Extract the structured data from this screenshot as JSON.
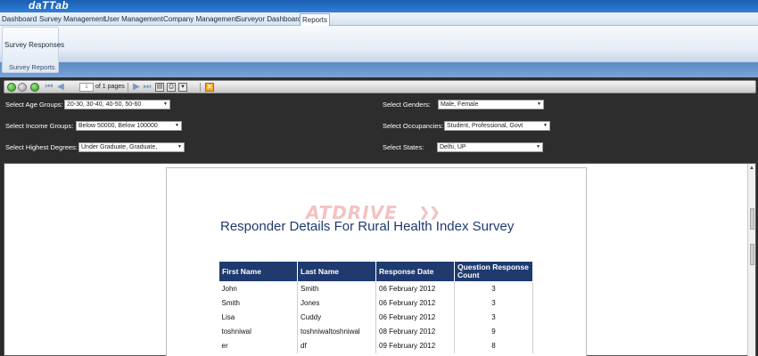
{
  "brand": "daTTab",
  "menu": [
    "Dashboard",
    "Survey Management",
    "User Management",
    "Company Management",
    "Surveyor Dashboard",
    "Reports"
  ],
  "ribbon": {
    "button": "Survey Responses",
    "group_label": "Survey Reports"
  },
  "toolbar": {
    "current_page": "1",
    "page_of": "of 1 pages"
  },
  "filters": {
    "age": {
      "label": "Select Age Groups:",
      "value": "20-30, 30-40, 40-50, 50-60"
    },
    "income": {
      "label": "Select Income Groups:",
      "value": "Below 50000, Below 100000"
    },
    "degree": {
      "label": "Select Highest Degrees:",
      "value": "Under Graduate, Graduate,"
    },
    "gender": {
      "label": "Select Genders:",
      "value": "Male, Female"
    },
    "occupancy": {
      "label": "Select Occupancies:",
      "value": "Student, Professional, Govt"
    },
    "state": {
      "label": "Select States:",
      "value": "Delhi, UP"
    }
  },
  "report": {
    "logo": "ATDRIVE",
    "title": "Responder Details For Rural Health Index Survey",
    "headers": [
      "First Name",
      "Last Name",
      "Response Date",
      "Question Response Count"
    ],
    "rows": [
      [
        "John",
        "Smith",
        "06 February 2012",
        "3"
      ],
      [
        "Smith",
        "Jones",
        "06 February 2012",
        "3"
      ],
      [
        "Lisa",
        "Cuddy",
        "06 February 2012",
        "3"
      ],
      [
        "toshniwal",
        "toshniwaltoshniwal",
        "08 February 2012",
        "9"
      ],
      [
        "er",
        "df",
        "09 February 2012",
        "8"
      ]
    ]
  }
}
